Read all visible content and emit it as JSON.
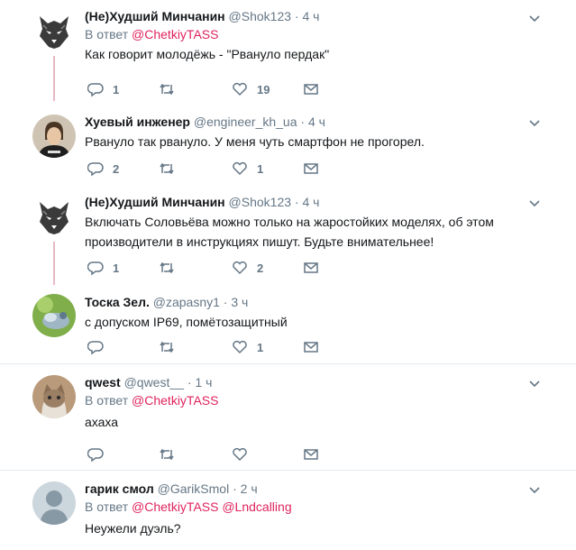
{
  "reply_prefix": "В ответ",
  "tweets": [
    {
      "name": "(Не)Худший Минчанин",
      "handle": "@Shok123",
      "dot": "·",
      "time": "4 ч",
      "reply_to": [
        "@ChetkiyTASS"
      ],
      "text": "Как говорит молодёжь - \"Рвануло пердак\"",
      "replies": "1",
      "retweets": "",
      "likes": "19",
      "avatar": "wolf-avatar"
    },
    {
      "name": "Хуевый инженер",
      "handle": "@engineer_kh_ua",
      "dot": "·",
      "time": "4 ч",
      "reply_to": [],
      "text": "Рвануло так рвануло. У меня чуть смартфон не прогорел.",
      "replies": "2",
      "retweets": "",
      "likes": "1",
      "avatar": "person-avatar"
    },
    {
      "name": "(Не)Худший Минчанин",
      "handle": "@Shok123",
      "dot": "·",
      "time": "4 ч",
      "reply_to": [],
      "text": "Включать Соловьёва можно только на жаростойких моделях, об этом производители в инструкциях пишут. Будьте внимательнее!",
      "replies": "1",
      "retweets": "",
      "likes": "2",
      "avatar": "wolf-avatar"
    },
    {
      "name": "Тоска Зел.",
      "handle": "@zapasny1",
      "dot": "·",
      "time": "3 ч",
      "reply_to": [],
      "text": "с допуском IP69, помётозащитный",
      "replies": "",
      "retweets": "",
      "likes": "1",
      "avatar": "bird-avatar"
    },
    {
      "name": "qwest",
      "handle": "@qwest__",
      "dot": "·",
      "time": "1 ч",
      "reply_to": [
        "@ChetkiyTASS"
      ],
      "text": "ахаха",
      "replies": "",
      "retweets": "",
      "likes": "",
      "avatar": "cat-avatar"
    },
    {
      "name": "гарик смол",
      "handle": "@GarikSmol",
      "dot": "·",
      "time": "2 ч",
      "reply_to": [
        "@ChetkiyTASS",
        "@Lndcalling"
      ],
      "text": "Неужели дуэль?",
      "replies": "",
      "retweets": "",
      "likes": "",
      "avatar": "default-avatar"
    }
  ],
  "colors": {
    "name": "#14171a",
    "secondary": "#657786",
    "mention": "#e0245e",
    "thread_line": "#e6b8c3",
    "separator": "#e6ecf0"
  }
}
